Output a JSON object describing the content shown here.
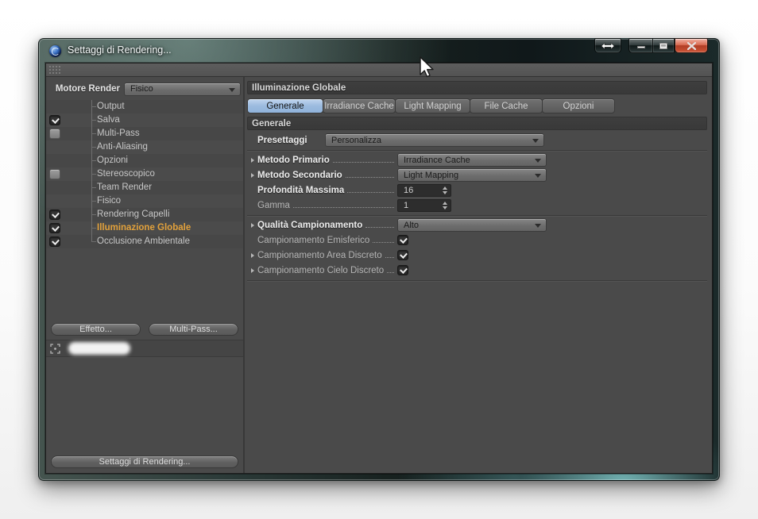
{
  "window": {
    "title": "Settaggi di Rendering...",
    "controls": {
      "resize": "horizontal-resize",
      "minimize": "minimize",
      "maximize": "maximize",
      "close": "close"
    }
  },
  "colors": {
    "selected_item_text": "#e2a13b",
    "tab_selected": "#9cbbdf",
    "close_button": "#c44c30",
    "panel_bg": "#4a4a4a",
    "strip_bg": "#3b3b3b"
  },
  "icons": {
    "app": "cinema4d-sphere-logo",
    "grip": "dot-grid-handle",
    "dropdown_arrow": "triangle-down",
    "expand_arrow": "triangle-right",
    "checkbox_check": "checkmark",
    "spinner": "up-down-triangles",
    "preview_target": "corner-brackets-with-dot",
    "cursor": "arrow-pointer"
  },
  "sidebar": {
    "engine_label": "Motore Render",
    "engine_value": "Fisico",
    "items": [
      {
        "label": "Output",
        "checkbox": "none"
      },
      {
        "label": "Salva",
        "checkbox": "checked"
      },
      {
        "label": "Multi-Pass",
        "checkbox": "unchecked"
      },
      {
        "label": "Anti-Aliasing",
        "checkbox": "none"
      },
      {
        "label": "Opzioni",
        "checkbox": "none"
      },
      {
        "label": "Stereoscopico",
        "checkbox": "unchecked"
      },
      {
        "label": "Team Render",
        "checkbox": "none"
      },
      {
        "label": "Fisico",
        "checkbox": "none"
      },
      {
        "label": "Rendering Capelli",
        "checkbox": "checked"
      },
      {
        "label": "Illuminazione Globale",
        "checkbox": "checked",
        "selected": true
      },
      {
        "label": "Occlusione Ambientale",
        "checkbox": "checked"
      }
    ],
    "effect_button": "Effetto...",
    "multipass_button": "Multi-Pass...",
    "render_settings_button": "Settaggi di Rendering..."
  },
  "main": {
    "header": "Illuminazione Globale",
    "tabs": [
      {
        "label": "Generale",
        "selected": true
      },
      {
        "label": "Irradiance Cache"
      },
      {
        "label": "Light Mapping"
      },
      {
        "label": "File Cache"
      },
      {
        "label": "Opzioni"
      }
    ],
    "section": "Generale",
    "params": [
      {
        "label": "Presettaggi",
        "control": "dropdown",
        "value": "Personalizza"
      },
      {
        "label": "Metodo Primario",
        "control": "dropdown",
        "value": "Irradiance Cache",
        "expandable": true
      },
      {
        "label": "Metodo Secondario",
        "control": "dropdown",
        "value": "Light Mapping",
        "expandable": true
      },
      {
        "label": "Profondità Massima",
        "control": "spinner",
        "value": "16"
      },
      {
        "label": "Gamma",
        "control": "spinner",
        "value": "1"
      },
      {
        "label": "Qualità Campionamento",
        "control": "dropdown",
        "value": "Alto",
        "expandable": true
      },
      {
        "label": "Campionamento Emisferico",
        "control": "checkbox",
        "state": "checked"
      },
      {
        "label": "Campionamento Area Discreto",
        "control": "checkbox",
        "state": "checked",
        "expandable": true
      },
      {
        "label": "Campionamento Cielo Discreto",
        "control": "checkbox",
        "state": "checked",
        "expandable": true
      }
    ]
  }
}
